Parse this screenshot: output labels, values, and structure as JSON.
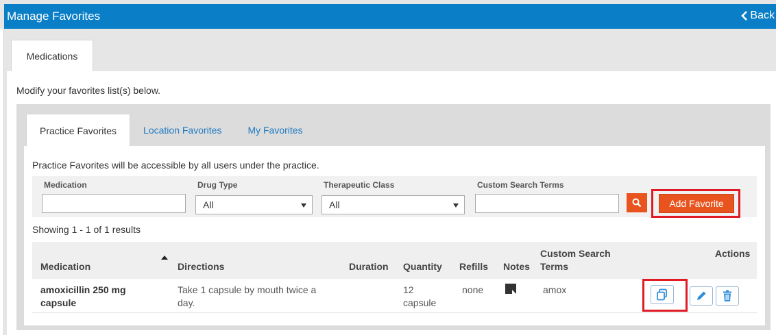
{
  "header": {
    "title": "Manage Favorites",
    "back_label": "Back"
  },
  "outer_tab": {
    "label": "Medications"
  },
  "intro": "Modify your favorites list(s) below.",
  "tabs": [
    {
      "label": "Practice Favorites",
      "active": true
    },
    {
      "label": "Location Favorites",
      "active": false
    },
    {
      "label": "My Favorites",
      "active": false
    }
  ],
  "tab_description": "Practice Favorites will be accessible by all users under the practice.",
  "filters": {
    "medication": {
      "label": "Medication",
      "value": ""
    },
    "drug_type": {
      "label": "Drug Type",
      "value": "All"
    },
    "therapeutic_class": {
      "label": "Therapeutic Class",
      "value": "All"
    },
    "custom_search_terms": {
      "label": "Custom Search Terms",
      "value": ""
    },
    "add_favorite_label": "Add Favorite"
  },
  "showing": "Showing 1 - 1 of 1 results",
  "columns": {
    "medication": "Medication",
    "directions": "Directions",
    "duration": "Duration",
    "quantity": "Quantity",
    "refills": "Refills",
    "notes": "Notes",
    "custom_search_terms_1": "Custom Search",
    "custom_search_terms_2": "Terms",
    "actions": "Actions"
  },
  "rows": [
    {
      "medication_1": "amoxicillin 250 mg",
      "medication_2": "capsule",
      "directions_1": "Take 1 capsule by mouth twice a",
      "directions_2": "day.",
      "duration": "",
      "quantity_1": "12",
      "quantity_2": "capsule",
      "refills": "none",
      "custom_search_terms": "amox"
    }
  ],
  "colors": {
    "header_bg": "#0a7fc7",
    "accent_orange": "#e8531e",
    "highlight_red": "#e01b24",
    "link_blue": "#1f7bc2",
    "icon_blue": "#2f8fdc"
  },
  "icons": {
    "back": "chevron-left-icon",
    "search": "search-icon",
    "copy": "copy-icon",
    "edit": "pencil-icon",
    "delete": "trash-icon",
    "note": "note-icon"
  }
}
